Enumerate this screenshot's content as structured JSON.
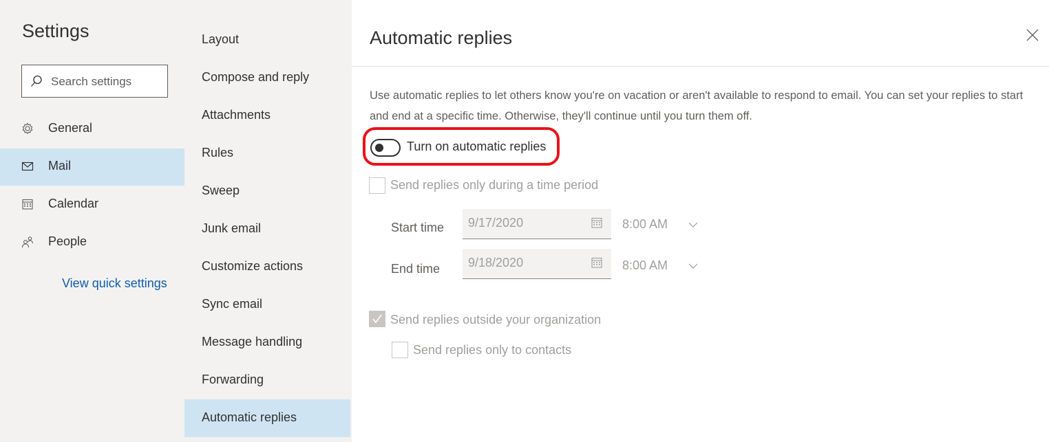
{
  "settings": {
    "title": "Settings",
    "search_placeholder": "Search settings",
    "nav": [
      {
        "label": "General",
        "icon": "gear-icon"
      },
      {
        "label": "Mail",
        "icon": "mail-icon"
      },
      {
        "label": "Calendar",
        "icon": "calendar-icon"
      },
      {
        "label": "People",
        "icon": "people-icon"
      }
    ],
    "quick_link": "View quick settings"
  },
  "mail_nav": [
    "Layout",
    "Compose and reply",
    "Attachments",
    "Rules",
    "Sweep",
    "Junk email",
    "Customize actions",
    "Sync email",
    "Message handling",
    "Forwarding",
    "Automatic replies"
  ],
  "content": {
    "title": "Automatic replies",
    "description": "Use automatic replies to let others know you're on vacation or aren't available to respond to email. You can set your replies to start and end at a specific time. Otherwise, they'll continue until you turn them off.",
    "toggle_label": "Turn on automatic replies",
    "time_period_label": "Send replies only during a time period",
    "start_label": "Start time",
    "start_date": "9/17/2020",
    "start_time": "8:00 AM",
    "end_label": "End time",
    "end_date": "9/18/2020",
    "end_time": "8:00 AM",
    "outside_label": "Send replies outside your organization",
    "contacts_label": "Send replies only to contacts"
  },
  "colors": {
    "selected_bg": "#cfe4f3",
    "link": "#0f5ea8",
    "annotation": "#e8121b"
  }
}
